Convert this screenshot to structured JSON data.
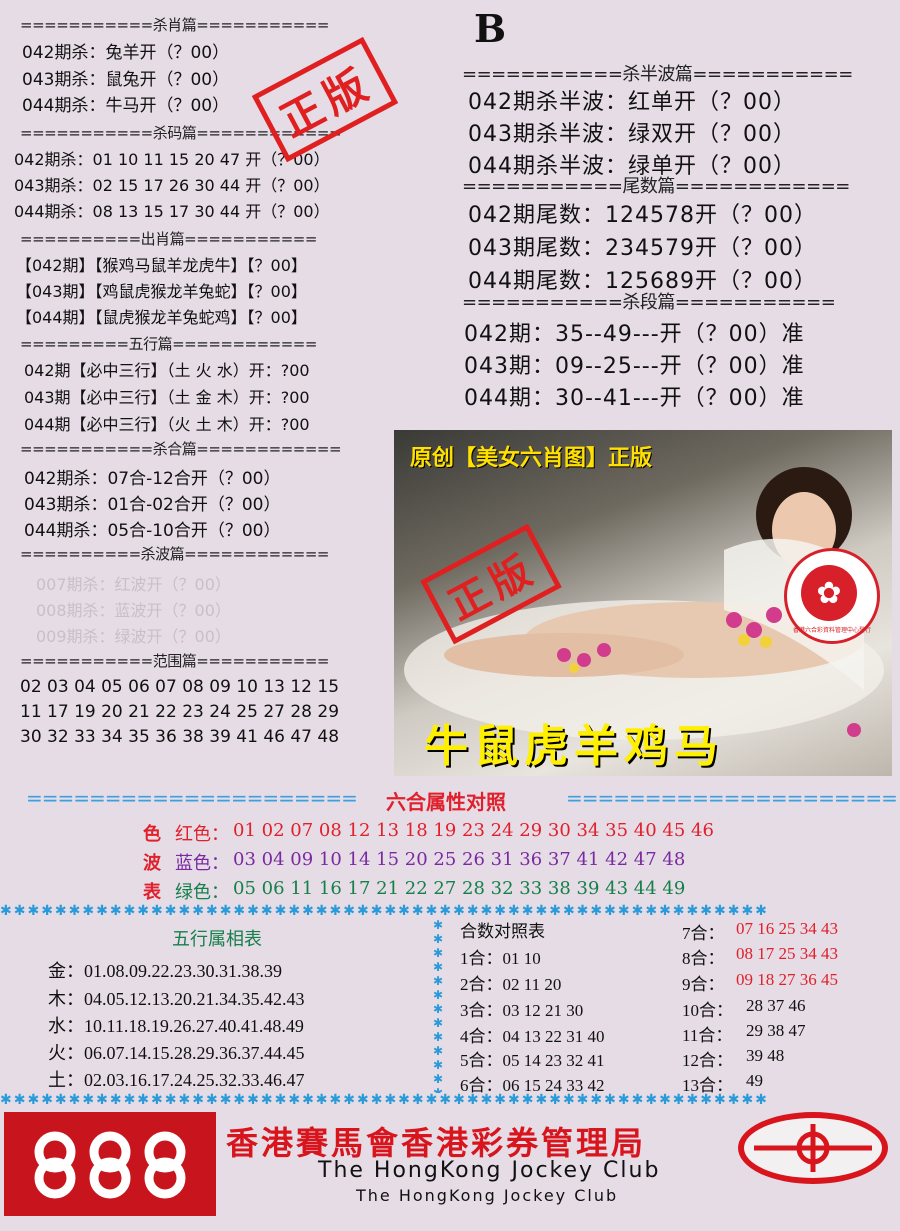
{
  "colors": {
    "red": "#e0202a",
    "blue": "#7a2aa0",
    "green": "#14804a",
    "sep_blue": "#3aa0e0",
    "stamp": "#e02020"
  },
  "left": {
    "sha_xiao": {
      "header": "===========杀肖篇===========",
      "rows": [
        "042期杀：兔羊开（？00）",
        "043期杀：鼠兔开（？00）",
        "044期杀：牛马开（？00）"
      ]
    },
    "sha_ma": {
      "header": "===========杀码篇============",
      "rows": [
        "042期杀：01 10 11 15 20 47 开（？00）",
        "043期杀：02 15 17 26 30 44 开（？00）",
        "044期杀：08 13 15 17 30 44 开（？00）"
      ]
    },
    "chu_xiao": {
      "header": "==========出肖篇===========",
      "rows": [
        "【042期】【猴鸡马鼠羊龙虎牛】【？00】",
        "【043期】【鸡鼠虎猴龙羊兔蛇】【？00】",
        "【044期】【鼠虎猴龙羊兔蛇鸡】【？00】"
      ]
    },
    "wu_xing": {
      "header": "=========五行篇============",
      "rows": [
        "042期【必中三行】（土 火 水）开：?00",
        "043期【必中三行】（土 金 木）开：?00",
        "044期【必中三行】（火 土 木）开：?00"
      ]
    },
    "sha_he": {
      "header": "===========杀合篇============",
      "rows": [
        "042期杀：07合-12合开（？00）",
        "043期杀：01合-02合开（？00）",
        "044期杀：05合-10合开（？00）"
      ]
    },
    "sha_bo": {
      "header": "==========杀波篇============",
      "rows": [
        "007期杀：红波开（？00）",
        "008期杀：蓝波开（？00）",
        "009期杀：绿波开（？00）"
      ]
    },
    "fan_wei": {
      "header": "===========范围篇===========",
      "rows": [
        "02 03 04 05 06 07 08 09 10 13 12  15",
        "11 17 19 20 21 22 23 24 25 27 28 29",
        "30 32 33 34 35 36 38 39 41 46 47 48"
      ]
    }
  },
  "right": {
    "badge": "B",
    "ban_bo": {
      "header": "===========杀半波篇===========",
      "rows": [
        "042期杀半波：红单开（？00）",
        "043期杀半波：绿双开（？00）",
        "044期杀半波：绿单开（？00）"
      ]
    },
    "wei_shu": {
      "header": "===========尾数篇============",
      "rows": [
        "042期尾数：124578开（？00）",
        "043期尾数：234579开（？00）",
        "044期尾数：125689开（？00）"
      ]
    },
    "sha_duan": {
      "header": "===========杀段篇===========",
      "rows": [
        "042期：35--49---开（？00）准",
        "043期：09--25---开（？00）准",
        "044期：30--41---开（？00）准"
      ]
    }
  },
  "stamp_text": "正版",
  "photo": {
    "title": "原创【美女六肖图】正版",
    "zodiacs": "牛鼠虎羊鸡马",
    "emblem_text": "香港六合彩資料管理中心發行"
  },
  "attr_table": {
    "header_left": "=====================",
    "title": "六合属性对照",
    "header_right": "=====================",
    "rows": [
      {
        "tag": "色",
        "label": "红色：",
        "nums": "01 02 07 08 12 13 18 19 23 24 29 30 34 35 40 45 46"
      },
      {
        "tag": "波",
        "label": "蓝色：",
        "nums": "03 04 09 10 14 15 20 25 26 31 36 37 41 42 47 48"
      },
      {
        "tag": "表",
        "label": "绿色：",
        "nums": "05 06 11 16 17 21 22 27 28 32 33 38 39 43 44 49"
      }
    ]
  },
  "wuxing_table": {
    "title": "五行属相表",
    "rows": [
      "金：01.08.09.22.23.30.31.38.39",
      "木：04.05.12.13.20.21.34.35.42.43",
      "水：10.11.18.19.26.27.40.41.48.49",
      "火：06.07.14.15.28.29.36.37.44.45",
      "土：02.03.16.17.24.25.32.33.46.47"
    ]
  },
  "heshu_table": {
    "title": "合数对照表",
    "col1": [
      "1合：01 10",
      "2合：02 11 20",
      "3合：03 12 21 30",
      "4合：04 13 22 31 40",
      "5合：05 14 23 32 41",
      "6合：06 15 24 33 42"
    ],
    "col2": [
      {
        "label": "7合：",
        "nums": "07 16 25 34 43",
        "red": true
      },
      {
        "label": "8合：",
        "nums": "08 17 25 34 43",
        "red": true
      },
      {
        "label": "9合：",
        "nums": "09 18 27 36 45",
        "red": true
      },
      {
        "label": "10合：",
        "nums": "28 37 46",
        "red": false
      },
      {
        "label": "11合：",
        "nums": "29 38 47",
        "red": false
      },
      {
        "label": "12合：",
        "nums": "39 48",
        "red": false
      },
      {
        "label": "13合：",
        "nums": "49",
        "red": false
      }
    ]
  },
  "footer": {
    "chinese": "香港賽馬會香港彩券管理局",
    "english1": "The HongKong Jockey Club",
    "english2": "The HongKong Jockey Club"
  }
}
